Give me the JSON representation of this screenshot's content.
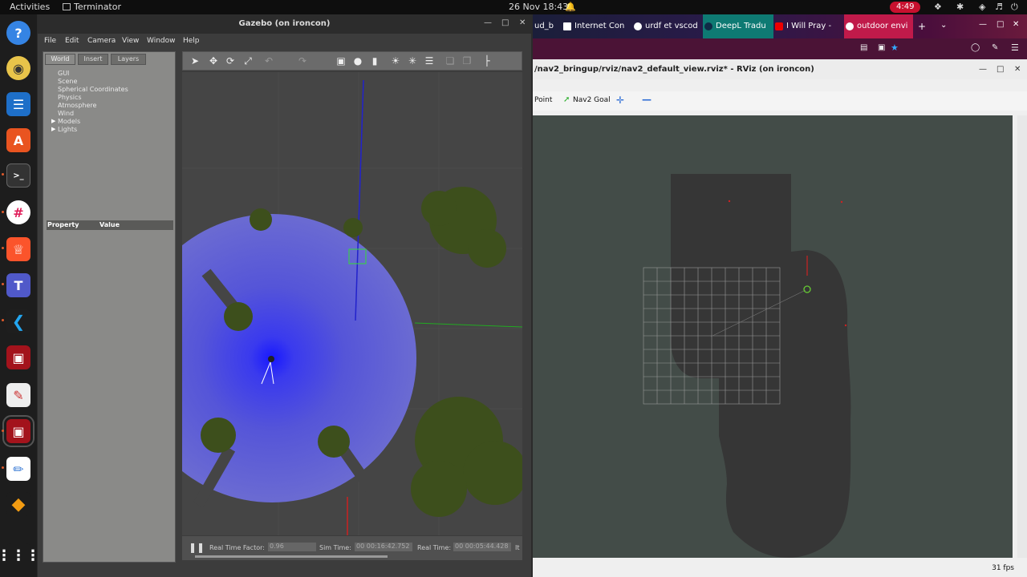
{
  "topbar": {
    "activities": "Activities",
    "app_name": "Terminator",
    "clock": "26 Nov  18:43",
    "bell_icon": "bell-icon",
    "battery": "4:49"
  },
  "dock": {
    "items": [
      "help-icon",
      "rhythmbox-icon",
      "writer-icon",
      "app-store-icon",
      "terminal-icon",
      "slack-icon",
      "brave-icon",
      "teams-icon",
      "vscode-icon",
      "terminator-icon",
      "text-editor-icon",
      "terminator-active-icon",
      "gedit-icon",
      "layers-icon",
      "apps-grid-icon"
    ]
  },
  "gazebo": {
    "title": "Gazebo (on ironcon)",
    "menu": [
      "File",
      "Edit",
      "Camera",
      "View",
      "Window",
      "Help"
    ],
    "tabs": [
      "World",
      "Insert",
      "Layers"
    ],
    "tree": [
      "GUI",
      "Scene",
      "Spherical Coordinates",
      "Physics",
      "Atmosphere",
      "Wind",
      "Models",
      "Lights"
    ],
    "prop_header": {
      "property": "Property",
      "value": "Value"
    },
    "status": {
      "rtf_label": "Real Time Factor:",
      "rtf_value": "0.96",
      "sim_label": "Sim Time:",
      "sim_value": "00 00:16:42.752",
      "real_label": "Real Time:",
      "real_value": "00 00:05:44.428",
      "it_label": "It"
    }
  },
  "browser": {
    "tabs": [
      {
        "label": "ud_b",
        "color": "#2a2a3a"
      },
      {
        "label": "Internet Con",
        "color": "#444"
      },
      {
        "label": "urdf et vscod",
        "color": "#ddd"
      },
      {
        "label": "DeepL Tradu",
        "color": "#0f2b46"
      },
      {
        "label": "I Will Pray -",
        "color": "#e00"
      },
      {
        "label": "outdoor envi",
        "color": "#ddd"
      }
    ]
  },
  "rviz": {
    "title": "/nav2_bringup/rviz/nav2_default_view.rviz* - RViz (on ironcon)",
    "tools": {
      "point": "Point",
      "nav_goal": "Nav2 Goal"
    },
    "fps": "31 fps"
  },
  "colors": {
    "battery": "#c8102e",
    "lidar": "#5b5bd6",
    "map_bg": "#434c48"
  }
}
